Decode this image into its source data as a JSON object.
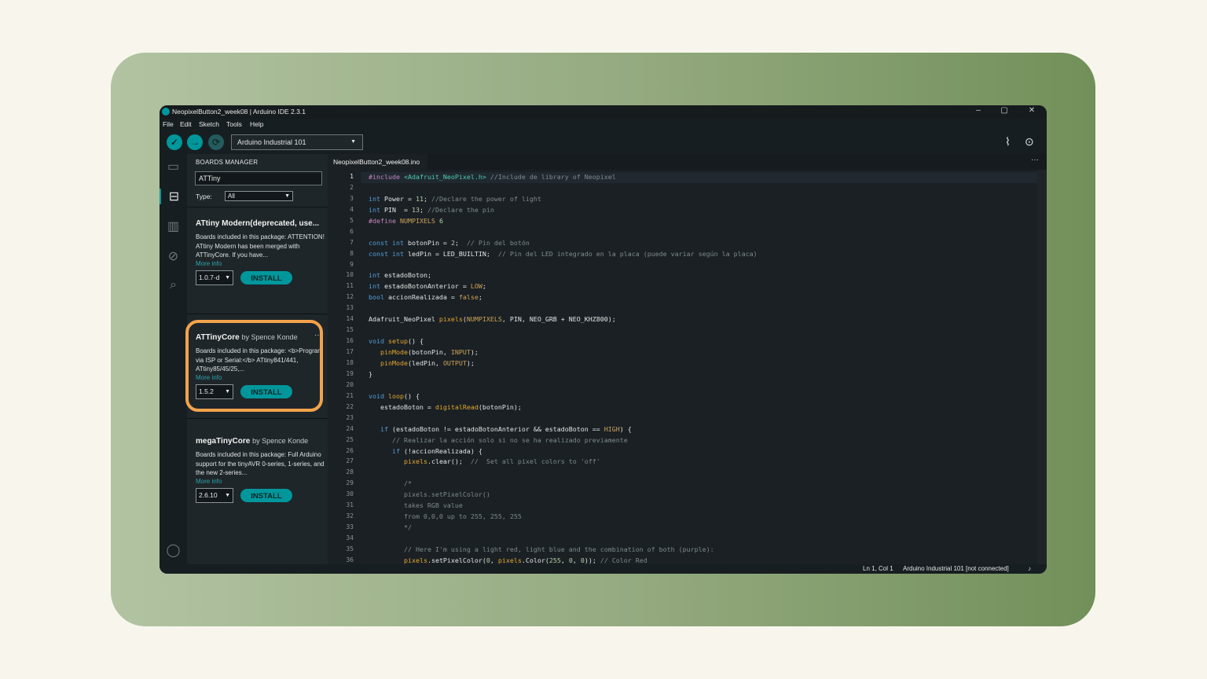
{
  "window": {
    "title": "NeopixelButton2_week08 | Arduino IDE 2.3.1",
    "controls": [
      "–",
      "▢",
      "✕"
    ]
  },
  "menu": [
    "File",
    "Edit",
    "Sketch",
    "Tools",
    "Help"
  ],
  "toolbar": {
    "verify_icon": "check-icon",
    "upload_icon": "arrow-right-icon",
    "debug_icon": "debug-icon",
    "board": "Arduino Industrial 101",
    "serial_plotter_icon": "plotter-icon",
    "serial_monitor_icon": "monitor-icon"
  },
  "colors": {
    "accent": "#00979c",
    "highlight": "#f3a34c",
    "background": "#f8f6ec",
    "frame": "#93a97e",
    "ide_bg": "#171e21"
  },
  "boards_manager": {
    "header": "BOARDS MANAGER",
    "search_value": "ATTiny",
    "type_label": "Type:",
    "type_value": "All",
    "cards": [
      {
        "name": "ATtiny Modern(deprecated, use...",
        "by": "",
        "desc": "Boards included in this package: ATTENTION! ATtiny Modern has been merged with ATTinyCore. If you have...",
        "more": "More info",
        "version": "1.0.7-d",
        "install": "INSTALL"
      },
      {
        "name": "ATTinyCore",
        "by": "by Spence Konde",
        "desc": "Boards included in this package: <b>Program via ISP or Serial:</b> ATtiny841/441, ATtiny85/45/25,...",
        "more": "More info",
        "version": "1.5.2",
        "install": "INSTALL"
      },
      {
        "name": "megaTinyCore",
        "by": "by Spence Konde",
        "desc": "Boards included in this package: Full Arduino support for the tinyAVR 0-series, 1-series, and the new 2-series...",
        "more": "More info",
        "version": "2.6.10",
        "install": "INSTALL"
      }
    ]
  },
  "editor": {
    "tab": "NeopixelButton2_week08.ino",
    "current_line": 1,
    "lines": [
      "#include <Adafruit_NeoPixel.h> //Include de library of Neopixel",
      "",
      "int Power = 11; //Declare the power of light",
      "int PIN  = 13; //Declare the pin",
      "#define NUMPIXELS 6",
      "",
      "const int botonPin = 2;  // Pin del botón",
      "const int ledPin = LED_BUILTIN;  // Pin del LED integrado en la placa (puede variar según la placa)",
      "",
      "int estadoBoton;",
      "int estadoBotonAnterior = LOW;",
      "bool accionRealizada = false;",
      "",
      "Adafruit_NeoPixel pixels(NUMPIXELS, PIN, NEO_GRB + NEO_KHZ800);",
      "",
      "void setup() {",
      "   pinMode(botonPin, INPUT);",
      "   pinMode(ledPin, OUTPUT);",
      "}",
      "",
      "void loop() {",
      "   estadoBoton = digitalRead(botonPin);",
      "",
      "   if (estadoBoton != estadoBotonAnterior && estadoBoton == HIGH) {",
      "      // Realizar la acción solo si no se ha realizado previamente",
      "      if (!accionRealizada) {",
      "         pixels.clear();  //  Set all pixel colors to 'off'",
      "",
      "         /*",
      "         pixels.setPixelColor()",
      "         takes RGB value",
      "         from 0,0,0 up to 255, 255, 255",
      "         */",
      "",
      "         // Here I'm using a light red, light blue and the combination of both (purple):",
      "         pixels.setPixelColor(0, pixels.Color(255, 0, 0)); // Color Red"
    ]
  },
  "status": {
    "position": "Ln 1, Col 1",
    "board": "Arduino Industrial 101 [not connected]",
    "bell_icon": "bell-icon"
  }
}
